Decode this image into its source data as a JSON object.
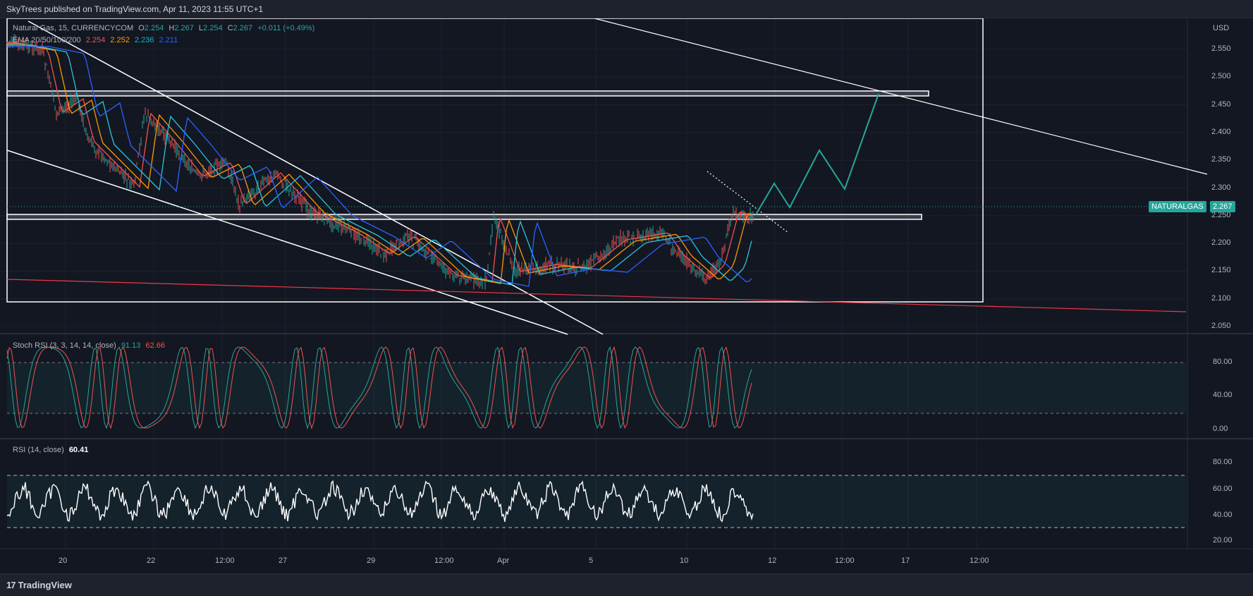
{
  "header": {
    "published_text": "SkyTrees published on TradingView.com, Apr 11, 2023 11:55 UTC+1"
  },
  "footer": {
    "logo_mark": "17",
    "logo_text": "TradingView"
  },
  "main_legend": {
    "symbol_line": "Natural Gas, 15, CURRENCYCOM",
    "open_label": "O",
    "open_value": "2.254",
    "high_label": "H",
    "high_value": "2.267",
    "low_label": "L",
    "low_value": "2.254",
    "close_label": "C",
    "close_value": "2.267",
    "change": "+0.011 (+0.49%)",
    "ema_label": "EMA 20/50/100/200",
    "ema_values": [
      "2.254",
      "2.252",
      "2.236",
      "2.211"
    ]
  },
  "stoch_legend": {
    "label": "Stoch RSI (3, 3, 14, 14, close)",
    "k_value": "91.13",
    "d_value": "62.66"
  },
  "rsi_legend": {
    "label": "RSI (14, close)",
    "value": "60.41"
  },
  "price_axis": {
    "currency": "USD",
    "ticks": [
      "2.550",
      "2.500",
      "2.450",
      "2.400",
      "2.350",
      "2.300",
      "2.250",
      "2.200",
      "2.150",
      "2.100",
      "2.050"
    ],
    "symbol_badge": "NATURALGAS",
    "last_price": "2.267"
  },
  "stoch_axis": {
    "ticks": [
      "80.00",
      "40.00",
      "0.00"
    ]
  },
  "rsi_axis": {
    "ticks": [
      "80.00",
      "60.00",
      "40.00",
      "20.00"
    ]
  },
  "time_axis": {
    "ticks": [
      "20",
      "22",
      "12:00",
      "27",
      "29",
      "12:00",
      "Apr",
      "5",
      "10",
      "12",
      "12:00",
      "17",
      "12:00"
    ]
  },
  "colors": {
    "background": "#131722",
    "candle_up": "#26a69a",
    "candle_down": "#ef5350",
    "ema20": "#ef5350",
    "ema50": "#ff9800",
    "ema100": "#26c6da",
    "ema200": "#2962ff",
    "projection": "#26a69a",
    "support_line": "#f23645"
  }
}
